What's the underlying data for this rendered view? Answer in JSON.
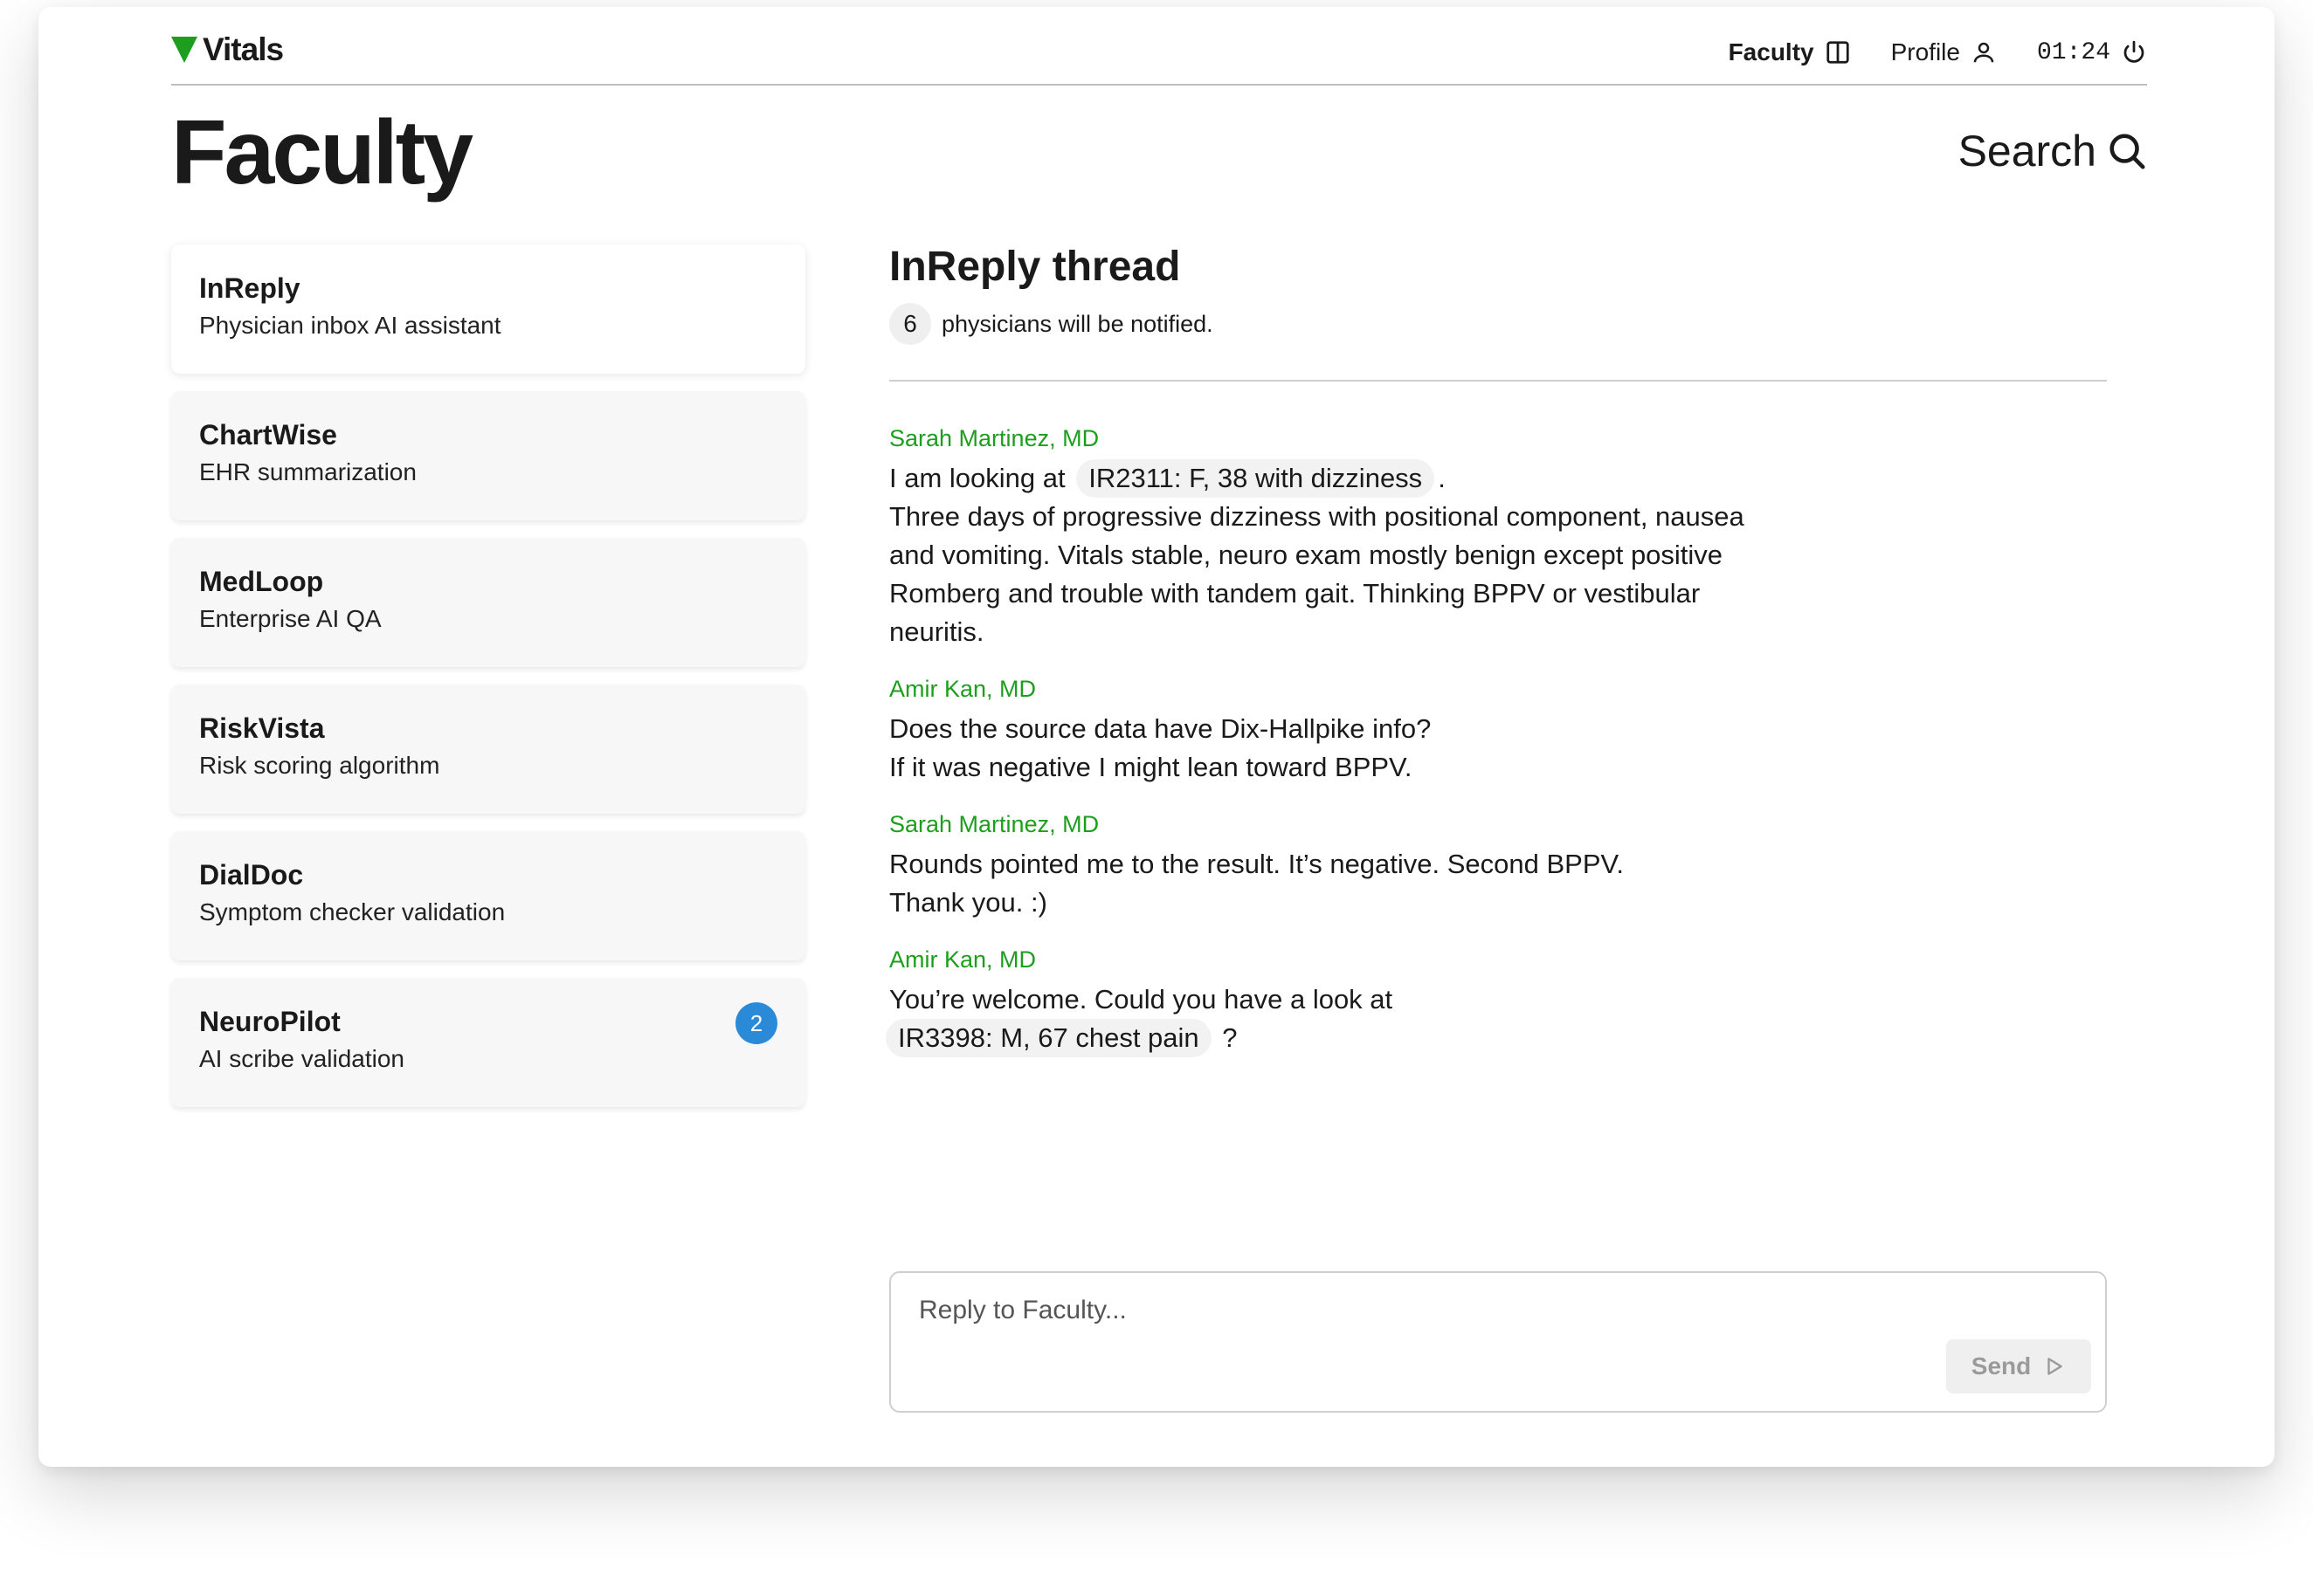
{
  "app": {
    "name": "Vitals"
  },
  "nav": {
    "faculty_label": "Faculty",
    "profile_label": "Profile",
    "clock": "01:24"
  },
  "page": {
    "title": "Faculty",
    "search_label": "Search"
  },
  "sidebar": {
    "items": [
      {
        "title": "InReply",
        "subtitle": "Physician inbox AI assistant"
      },
      {
        "title": "ChartWise",
        "subtitle": "EHR summarization"
      },
      {
        "title": "MedLoop",
        "subtitle": "Enterprise AI QA"
      },
      {
        "title": "RiskVista",
        "subtitle": "Risk scoring algorithm"
      },
      {
        "title": "DialDoc",
        "subtitle": "Symptom checker validation"
      },
      {
        "title": "NeuroPilot",
        "subtitle": "AI scribe validation",
        "badge": "2"
      }
    ]
  },
  "thread": {
    "title": "InReply thread",
    "notify_count": "6",
    "notify_text": "physicians will be notified.",
    "messages": [
      {
        "author": "Sarah Martinez, MD",
        "pre": "I am looking at",
        "ref": "IR2311: F, 38 with dizziness",
        "post": ".",
        "text": "Three days of progressive dizziness with positional component, nausea and vomiting. Vitals stable, neuro exam mostly benign except positive Romberg and trouble with tandem gait. Thinking BPPV or vestibular neuritis."
      },
      {
        "author": "Amir Kan, MD",
        "line1": "Does the source data have Dix-Hallpike info?",
        "line2": "If it was negative I might lean toward BPPV."
      },
      {
        "author": "Sarah Martinez, MD",
        "line1": "Rounds pointed me to the result. It’s negative. Second BPPV.",
        "line2": "Thank you. :)"
      },
      {
        "author": "Amir Kan, MD",
        "pre": "You’re welcome. Could you have a look at",
        "ref": "IR3398: M, 67 chest pain",
        "post": "?"
      }
    ]
  },
  "reply": {
    "placeholder": "Reply to Faculty...",
    "send_label": "Send"
  },
  "colors": {
    "brand_green": "#1e9e1e",
    "badge_blue": "#2a8ad8"
  },
  "icons": [
    "logo-triangle-icon",
    "sidebar-panel-icon",
    "user-icon",
    "power-icon",
    "search-icon",
    "send-arrow-icon"
  ]
}
